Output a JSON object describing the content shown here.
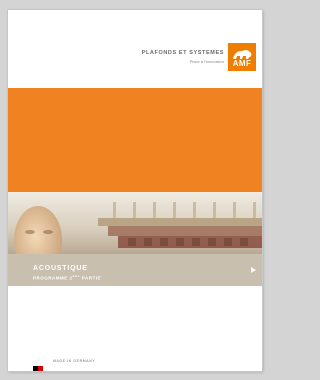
{
  "brand": {
    "title": "PLAFONDS ET SYSTEMES",
    "tagline": "Place à l'innovation",
    "logo_text": "AMF",
    "logo_color": "#ef7d00"
  },
  "band": {
    "orange": "#f08221"
  },
  "cover": {
    "title": "ACOUSTIQUE",
    "subtitle_prefix": "PROGRAMME 2",
    "subtitle_sup": "ème",
    "subtitle_suffix": " PARTIE"
  },
  "footer": {
    "made_in": "MADE IN GERMANY",
    "flag_colors": [
      "#000000",
      "#dd0000",
      "#ffce00"
    ]
  }
}
